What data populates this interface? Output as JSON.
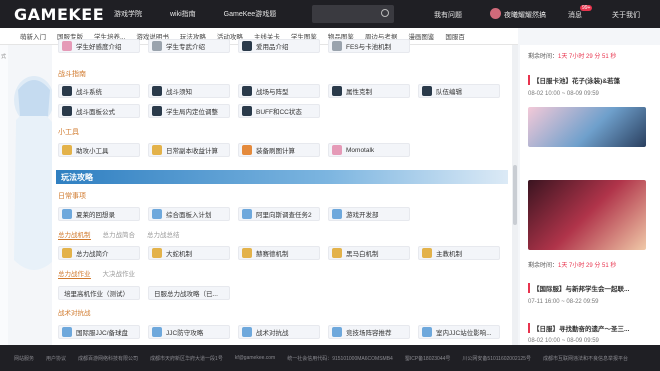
{
  "topbar": {
    "logo": "GAMEKEE",
    "nav": [
      "游戏学院",
      "wiki指南",
      "GameKee游戏题"
    ],
    "create_entry": "我有问题",
    "username": "夜曦耀耀然搞",
    "messages_label": "消息",
    "messages_badge": "99+",
    "about": "关于我们"
  },
  "subnav": [
    "萌新入门",
    "国服专版",
    "学生培养...",
    "游戏说明书",
    "玩法攻略",
    "活动攻略",
    "主线关卡",
    "学生图鉴",
    "物品图鉴",
    "周边与考据",
    "漫画图鉴",
    "国服百"
  ],
  "left_strip": [
    "式"
  ],
  "main": {
    "top_cards": [
      "学生好感度介绍",
      "学生专武介绍",
      "爱用品介绍",
      "FES与卡池机制"
    ],
    "battle_guide": {
      "title": "战斗指南",
      "cards": [
        "战斗系统",
        "战斗须知",
        "战场与阵型",
        "属性克制",
        "战斗面板公式",
        "学生局内定位调整",
        "BUFF和CC状态",
        "队伍编辑"
      ]
    },
    "tools": {
      "title": "小工具",
      "cards": [
        "助攻小工具",
        "日常副本收益计算",
        "装备刷图计算",
        "Momotalk"
      ]
    },
    "section_title": "玩法攻略",
    "daily": {
      "title": "日常事项",
      "cards": [
        "夏莱的回想录",
        "综合面板入计划",
        "阿里向斯调查任务2",
        "游戏开发部"
      ]
    },
    "raid_tabs": [
      "总力战机制",
      "总力战简合",
      "总力战总结"
    ],
    "raid_cards": [
      "总力战简介",
      "大蛇机制",
      "赫赛德机制",
      "黑马白机制",
      "主教机制"
    ],
    "grand_tabs": [
      "总力战作业",
      "大决战作业"
    ],
    "grand_cards": [
      "培里高机作业（测试）",
      "日服总力战攻略（已..."
    ],
    "tactic": {
      "title": "战术对抗战",
      "cards": [
        "国际服JJC/备球盘",
        "JJC防守攻略",
        "战术对抗战",
        "竞技场阵容推荐",
        "室内JJC站位影响..."
      ]
    }
  },
  "right": {
    "countdown1": {
      "prefix": "剩余时间：",
      "time": "1天 7小时 29 分 51 秒"
    },
    "event1": {
      "title": "【日服卡池】花子(泳装)&若藻",
      "date": "08-02 10:00 ~ 08-09 09:59"
    },
    "countdown2": {
      "prefix": "剩余时间：",
      "time": "1天 7小时 29 分 51 秒"
    },
    "event2": {
      "title": "【国际服】与新邦学生会一起联...",
      "date": "07-11 16:00 ~ 08-22 09:59"
    },
    "event3": {
      "title": "【日服】寻找勤奋的遗产～圣三...",
      "date": "08-02 10:00 ~ 08-09 09:59"
    }
  },
  "footer": [
    "网站服务",
    "用户协议",
    "成都百游网络科技有限公司",
    "成都市天府新区华府大道一段1号",
    "kf@gamekee.com",
    "统一社会信用代码：915101000MA6COMSMB4",
    "蜀ICP备18023044号",
    "川公网安备51011602002125号",
    "成都市互联网违法和不良信息举报平台"
  ],
  "colors": {
    "accent": "#d0792c",
    "header": "#1f1f24",
    "link_blue": "#2f7fc1",
    "badge_red": "#e8344e"
  }
}
